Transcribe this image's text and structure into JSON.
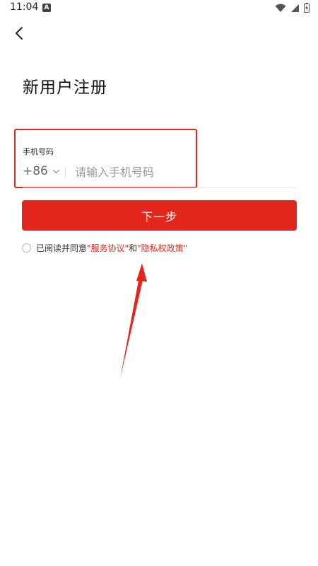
{
  "status_bar": {
    "time": "11:04",
    "notif_letter": "A"
  },
  "header": {
    "title": "新用户注册"
  },
  "phone_field": {
    "label": "手机号码",
    "country_code": "+86",
    "placeholder": "请输入手机号码",
    "value": ""
  },
  "next_button": {
    "label": "下一步"
  },
  "agreement": {
    "prefix": "已阅读并同意",
    "terms_link": "\"服务协议\"",
    "and": "和",
    "privacy_link": "\"隐私权政策\"",
    "checked": false
  },
  "colors": {
    "accent": "#e3271d",
    "highlight": "#e2251b"
  }
}
